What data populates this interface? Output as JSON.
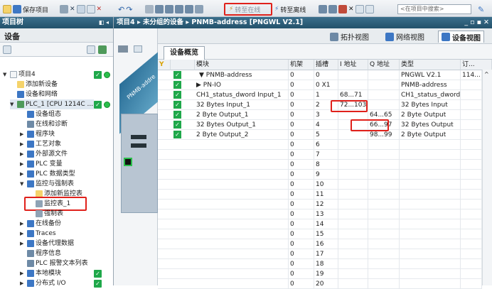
{
  "toolbar": {
    "save_label": "保存项目",
    "go_online_label": "转至在线",
    "go_offline_label": "转至离线",
    "search_placeholder": "<在项目中搜索>"
  },
  "project_tree": {
    "title": "项目树",
    "tab": "设备",
    "items": [
      {
        "label": "项目4",
        "level": 0,
        "expanded": true
      },
      {
        "label": "添加新设备",
        "level": 1
      },
      {
        "label": "设备和网络",
        "level": 1
      },
      {
        "label": "PLC_1 [CPU 1214C ...",
        "level": 1,
        "expanded": true
      },
      {
        "label": "设备组态",
        "level": 2
      },
      {
        "label": "在线和诊断",
        "level": 2
      },
      {
        "label": "程序块",
        "level": 2,
        "collapsed": true
      },
      {
        "label": "工艺对象",
        "level": 2,
        "collapsed": true
      },
      {
        "label": "外部源文件",
        "level": 2,
        "collapsed": true
      },
      {
        "label": "PLC 变量",
        "level": 2,
        "collapsed": true
      },
      {
        "label": "PLC 数据类型",
        "level": 2,
        "collapsed": true
      },
      {
        "label": "监控与强制表",
        "level": 2,
        "expanded": true
      },
      {
        "label": "添加新监控表",
        "level": 3
      },
      {
        "label": "监控表_1",
        "level": 3
      },
      {
        "label": "强制表",
        "level": 3
      },
      {
        "label": "在线备份",
        "level": 2,
        "collapsed": true
      },
      {
        "label": "Traces",
        "level": 2,
        "collapsed": true
      },
      {
        "label": "设备代理数据",
        "level": 2,
        "collapsed": true
      },
      {
        "label": "程序信息",
        "level": 2
      },
      {
        "label": "PLC 报警文本列表",
        "level": 2
      },
      {
        "label": "本地模块",
        "level": 2,
        "collapsed": true
      },
      {
        "label": "分布式 I/O",
        "level": 2,
        "collapsed": true
      }
    ]
  },
  "breadcrumb": {
    "project": "项目4",
    "group": "未分组的设备",
    "device": "PNMB-address [PNGWL V2.1]"
  },
  "views": {
    "topology": "拓扑视图",
    "network": "网络视图",
    "device": "设备视图"
  },
  "subtab": "设备概览",
  "table": {
    "headers": [
      "模块",
      "机架",
      "插槽",
      "I 地址",
      "Q 地址",
      "类型",
      "订..."
    ],
    "rows": [
      {
        "module": "PNMB-address",
        "rack": "0",
        "slot": "0",
        "i": "",
        "q": "",
        "type": "PNGWL V2.1",
        "order": "114...",
        "check": true
      },
      {
        "module": "PN-IO",
        "rack": "0",
        "slot": "0 X1",
        "i": "",
        "q": "",
        "type": "PNMB-address",
        "order": "",
        "check": true
      },
      {
        "module": "CH1_status_dword Input_1",
        "rack": "0",
        "slot": "1",
        "i": "68...71",
        "q": "",
        "type": "CH1_status_dword ...",
        "order": "",
        "check": true
      },
      {
        "module": "32 Bytes Input_1",
        "rack": "0",
        "slot": "2",
        "i": "72...103",
        "q": "",
        "type": "32 Bytes Input",
        "order": "",
        "check": true
      },
      {
        "module": "2 Byte Output_1",
        "rack": "0",
        "slot": "3",
        "i": "",
        "q": "64...65",
        "type": "2 Byte Output",
        "order": "",
        "check": true
      },
      {
        "module": "32 Bytes Output_1",
        "rack": "0",
        "slot": "4",
        "i": "",
        "q": "66...97",
        "type": "32 Bytes Output",
        "order": "",
        "check": true
      },
      {
        "module": "2 Byte Output_2",
        "rack": "0",
        "slot": "5",
        "i": "",
        "q": "98...99",
        "type": "2 Byte Output",
        "order": "",
        "check": true
      },
      {
        "module": "",
        "rack": "0",
        "slot": "6",
        "i": "",
        "q": "",
        "type": "",
        "order": "",
        "check": false
      },
      {
        "module": "",
        "rack": "0",
        "slot": "7",
        "i": "",
        "q": "",
        "type": "",
        "order": "",
        "check": false
      },
      {
        "module": "",
        "rack": "0",
        "slot": "8",
        "i": "",
        "q": "",
        "type": "",
        "order": "",
        "check": false
      },
      {
        "module": "",
        "rack": "0",
        "slot": "9",
        "i": "",
        "q": "",
        "type": "",
        "order": "",
        "check": false
      },
      {
        "module": "",
        "rack": "0",
        "slot": "10",
        "i": "",
        "q": "",
        "type": "",
        "order": "",
        "check": false
      },
      {
        "module": "",
        "rack": "0",
        "slot": "11",
        "i": "",
        "q": "",
        "type": "",
        "order": "",
        "check": false
      },
      {
        "module": "",
        "rack": "0",
        "slot": "12",
        "i": "",
        "q": "",
        "type": "",
        "order": "",
        "check": false
      },
      {
        "module": "",
        "rack": "0",
        "slot": "13",
        "i": "",
        "q": "",
        "type": "",
        "order": "",
        "check": false
      },
      {
        "module": "",
        "rack": "0",
        "slot": "14",
        "i": "",
        "q": "",
        "type": "",
        "order": "",
        "check": false
      },
      {
        "module": "",
        "rack": "0",
        "slot": "15",
        "i": "",
        "q": "",
        "type": "",
        "order": "",
        "check": false
      },
      {
        "module": "",
        "rack": "0",
        "slot": "16",
        "i": "",
        "q": "",
        "type": "",
        "order": "",
        "check": false
      },
      {
        "module": "",
        "rack": "0",
        "slot": "17",
        "i": "",
        "q": "",
        "type": "",
        "order": "",
        "check": false
      },
      {
        "module": "",
        "rack": "0",
        "slot": "18",
        "i": "",
        "q": "",
        "type": "",
        "order": "",
        "check": false
      },
      {
        "module": "",
        "rack": "0",
        "slot": "19",
        "i": "",
        "q": "",
        "type": "",
        "order": "",
        "check": false
      },
      {
        "module": "",
        "rack": "0",
        "slot": "20",
        "i": "",
        "q": "",
        "type": "",
        "order": "",
        "check": false
      }
    ]
  },
  "device_label": "PNMB-addre",
  "colors": {
    "title_bar": "#23516b",
    "highlight": "#e0211b",
    "status_green": "#1fa84a"
  }
}
